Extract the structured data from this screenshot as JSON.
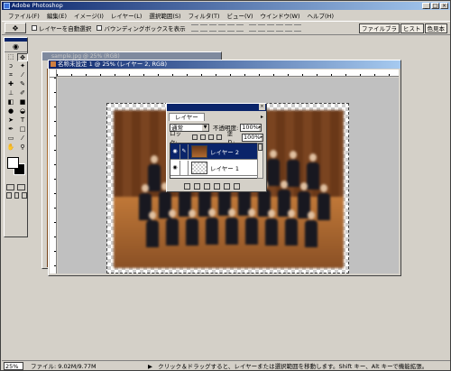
{
  "window": {
    "title": "Adobe Photoshop"
  },
  "menu": [
    "ファイル(F)",
    "編集(E)",
    "イメージ(I)",
    "レイヤー(L)",
    "選択範囲(S)",
    "フィルタ(T)",
    "ビュー(V)",
    "ウインドウ(W)",
    "ヘルプ(H)"
  ],
  "options": {
    "auto_select_layer": "レイヤーを自動選択",
    "show_bounding_box": "バウンディングボックスを表示"
  },
  "palette_well": [
    "ファイルブラ",
    "ヒスト",
    "色見本"
  ],
  "doc_back": {
    "title": "sample.jpg @ 25% (RGB)"
  },
  "doc_front": {
    "title": "名称未設定 1 @ 25% (レイヤー 2, RGB)"
  },
  "layers_palette": {
    "tab": "レイヤー",
    "blend_mode": "通常",
    "opacity_label": "不透明度:",
    "opacity_value": "100%",
    "lock_label": "ロック:",
    "fill_label": "塗り:",
    "fill_value": "100%",
    "layers": [
      {
        "name": "レイヤー 2",
        "selected": true
      },
      {
        "name": "レイヤー 1",
        "selected": false
      }
    ]
  },
  "status": {
    "zoom": "25%",
    "file_size": "ファイル: 9.02M/9.77M",
    "tip": "クリック＆ドラッグすると、レイヤーまたは選択範囲を移動します。Shift キー、Alt キーで機能拡張。"
  },
  "colors": {
    "title_bar": "#0a246a",
    "chrome": "#d4d0c8",
    "selected_layer": "#0a246a"
  },
  "icons": {
    "move_tool": "move-icon",
    "eye": "eye-icon",
    "brush": "brush-icon"
  }
}
